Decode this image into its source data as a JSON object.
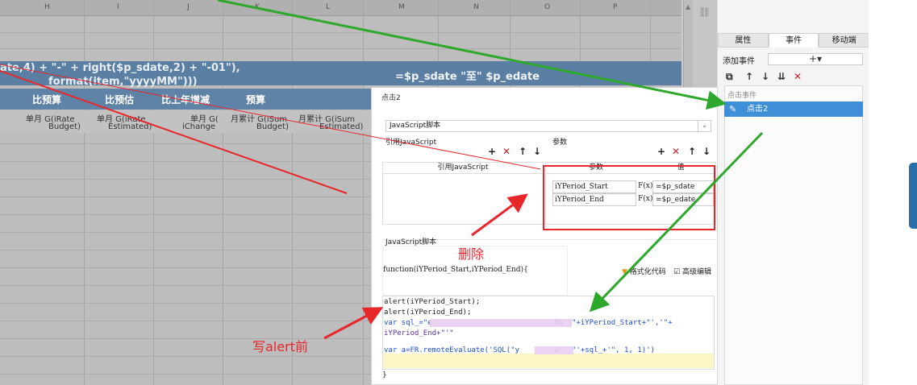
{
  "sheet": {
    "columns": [
      "H",
      "I",
      "J",
      "K",
      "L",
      "M",
      "N",
      "O",
      "P"
    ],
    "formula_line1": "ate,4) + \"-\" + right($p_sdate,2) + \"-01\"),",
    "formula_line2": "format(item,\"yyyyMM\")))",
    "band_right": "=$p_sdate \"至\" $p_edate",
    "header_cells": [
      "比预算",
      "比预估",
      "比上年增减",
      "预算"
    ],
    "sub_cells": [
      "单月 G(iRate",
      "单月 G(iRate",
      "单月 G(",
      "月累计 G(iSum",
      "月累计 G(iSum"
    ],
    "sub_cells2": [
      "Budget)",
      "Estimated)",
      "iChange",
      "Budget)",
      "Estimated)"
    ]
  },
  "panel": {
    "tabs": [
      "属性",
      "事件",
      "移动端"
    ],
    "active_tab": "事件",
    "add_event_label": "添加事件",
    "add_button": "+▾",
    "event_section_label": "点击事件",
    "event_item": "点击2"
  },
  "dialog": {
    "title": "点击2",
    "type_value": "JavaScript脚本",
    "ref_js_label": "引用JavaScript",
    "params_label": "参数",
    "ref_js_col": "引用JavaScript",
    "param_col": "参数",
    "value_col": "值",
    "params": [
      {
        "name": "iYPeriod_Start",
        "fx": "F(x)",
        "value": "=$p_sdate"
      },
      {
        "name": "iYPeriod_End",
        "fx": "F(x)",
        "value": "=$p_edate"
      }
    ],
    "script_label": "JavaScript脚本",
    "function_sig": "function(iYPeriod_Start,iYPeriod_End){",
    "format_code": "格式化代码",
    "advanced_edit": "高级编辑",
    "code_lines": [
      "alert(iYPeriod_Start);",
      "alert(iYPeriod_End);",
      "var sql_=\"e                            Dw '\"+iYPeriod_Start+\"','\"+",
      "iYPeriod_End+\"'\"",
      "",
      "var a=FR.remoteEvaluate('SQL(\"y        w\", \"'+sql_+'\", 1, 1)')"
    ],
    "closing": "}"
  },
  "annotations": {
    "delete_note": "删除",
    "write_alert_note": "写alert前"
  },
  "colors": {
    "annotation_red": "#e8272b",
    "arrow_green": "#2ea82c",
    "selection_blue": "#3f8fd8"
  }
}
